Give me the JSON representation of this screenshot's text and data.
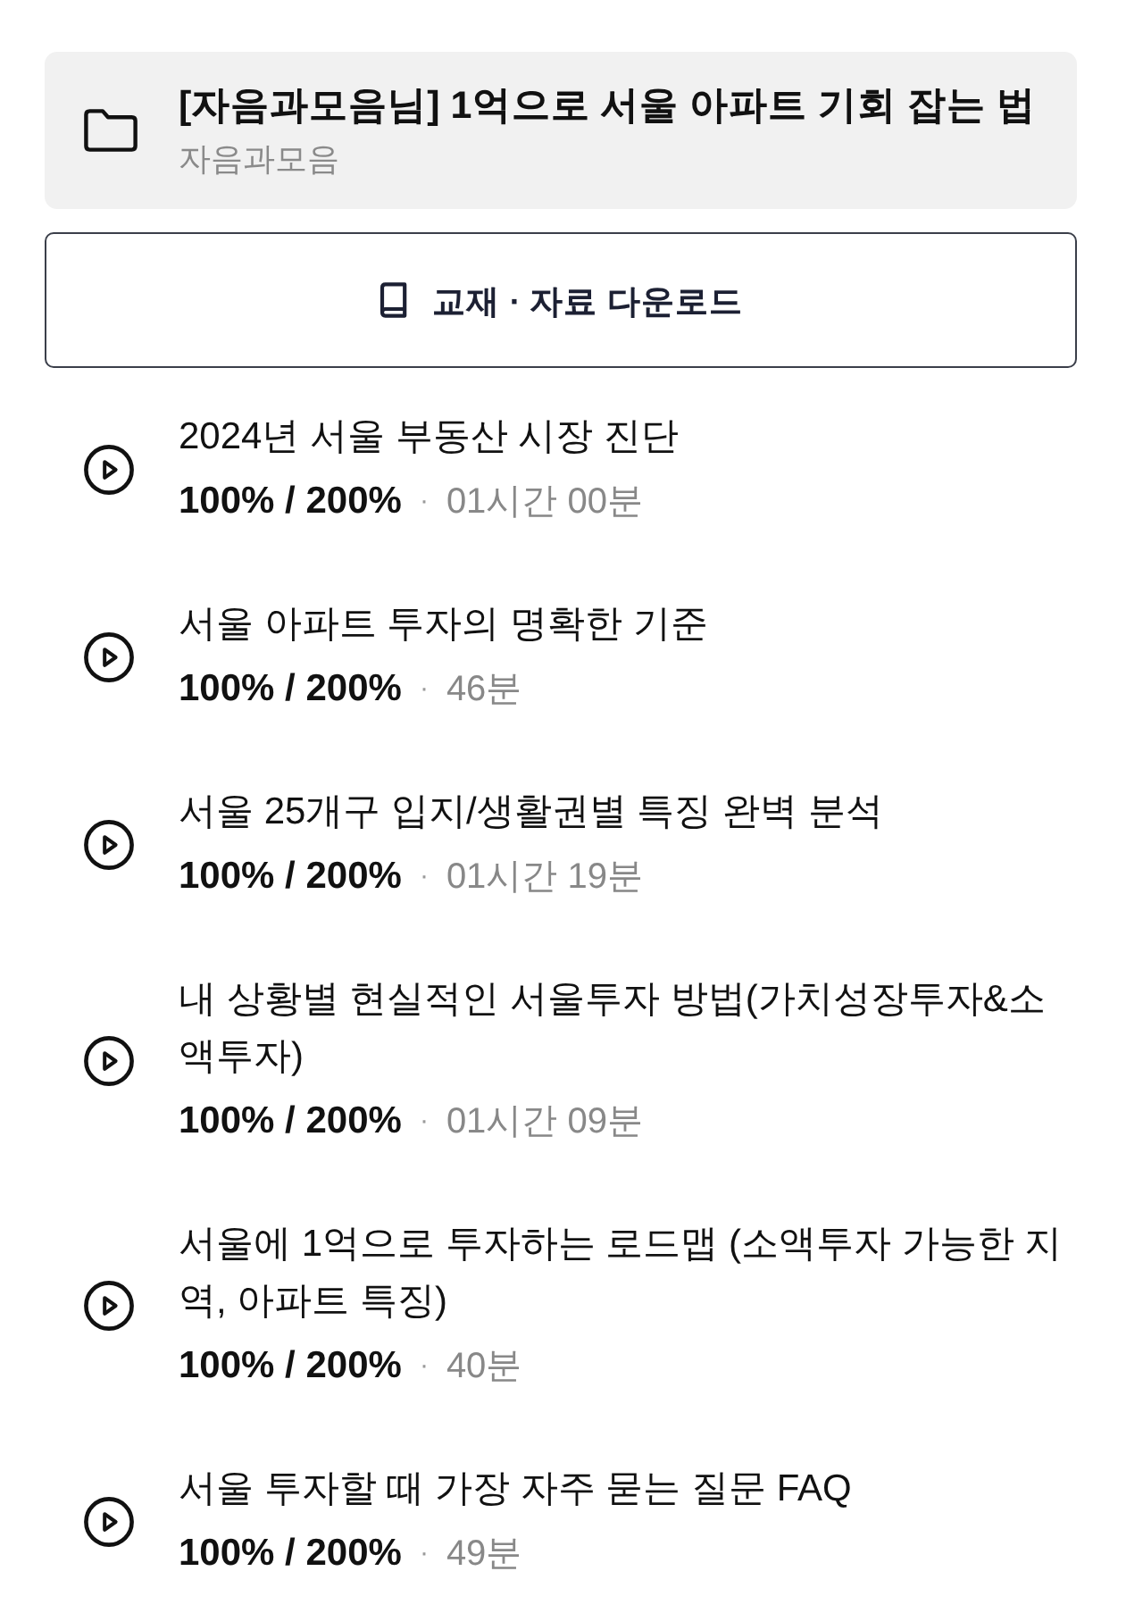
{
  "course": {
    "title": "[자음과모음님] 1억으로 서울 아파트 기회 잡는 법",
    "author": "자음과모음"
  },
  "download_button": {
    "label": "교재 · 자료 다운로드"
  },
  "lessons": [
    {
      "title": "2024년 서울 부동산 시장 진단",
      "ratio": "100% / 200%",
      "separator": "·",
      "duration": "01시간 00분"
    },
    {
      "title": "서울 아파트 투자의 명확한 기준",
      "ratio": "100% / 200%",
      "separator": "·",
      "duration": "46분"
    },
    {
      "title": "서울 25개구 입지/생활권별 특징 완벽 분석",
      "ratio": "100% / 200%",
      "separator": "·",
      "duration": "01시간 19분"
    },
    {
      "title": "내 상황별 현실적인 서울투자 방법(가치성장투자&소액투자)",
      "ratio": "100% / 200%",
      "separator": "·",
      "duration": "01시간 09분"
    },
    {
      "title": "서울에 1억으로 투자하는 로드맵 (소액투자 가능한 지역, 아파트 특징)",
      "ratio": "100% / 200%",
      "separator": "·",
      "duration": "40분"
    },
    {
      "title": "서울 투자할 때 가장 자주 묻는 질문 FAQ",
      "ratio": "100% / 200%",
      "separator": "·",
      "duration": "49분"
    }
  ]
}
